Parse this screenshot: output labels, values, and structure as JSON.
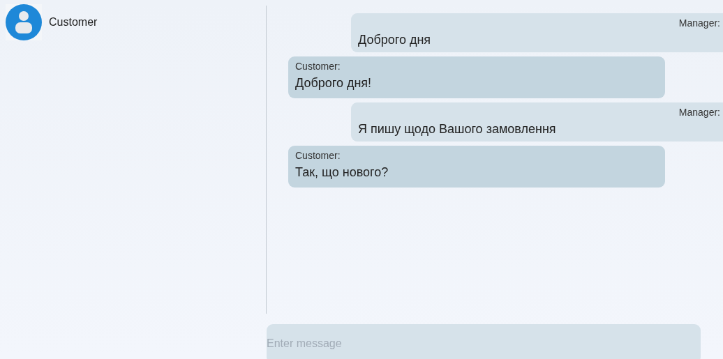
{
  "contacts": [
    {
      "name": "Customer"
    }
  ],
  "messages": [
    {
      "kind": "outgoing",
      "sender": "Manager:",
      "text": "Доброго дня"
    },
    {
      "kind": "incoming",
      "sender": "Customer:",
      "text": "Доброго дня!"
    },
    {
      "kind": "outgoing",
      "sender": "Manager:",
      "text": "Я пишу щодо Вашого замовлення"
    },
    {
      "kind": "incoming",
      "sender": "Customer:",
      "text": "Так, що нового?"
    }
  ],
  "composer": {
    "placeholder": "Enter message"
  }
}
